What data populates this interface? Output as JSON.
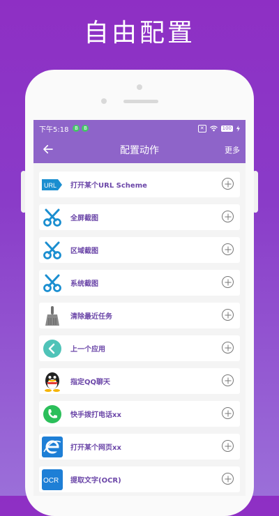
{
  "hero_title": "自由配置",
  "status": {
    "time": "下午5:18",
    "badge1": "B",
    "badge2": "B",
    "right_box": "✕",
    "battery": "100"
  },
  "appbar": {
    "title": "配置动作",
    "more_label": "更多"
  },
  "items": [
    {
      "label": "打开某个URL Scheme",
      "icon": "url-icon",
      "icon_text": "URL"
    },
    {
      "label": "全屏截图",
      "icon": "scissors-icon"
    },
    {
      "label": "区域截图",
      "icon": "scissors-icon"
    },
    {
      "label": "系统截图",
      "icon": "scissors-icon"
    },
    {
      "label": "清除最近任务",
      "icon": "broom-icon"
    },
    {
      "label": "上一个应用",
      "icon": "back-arrow-icon"
    },
    {
      "label": "指定QQ聊天",
      "icon": "qq-penguin-icon"
    },
    {
      "label": "快手拨打电话xx",
      "icon": "phone-icon"
    },
    {
      "label": "打开某个网页xx",
      "icon": "browser-e-icon"
    },
    {
      "label": "提取文字(OCR)",
      "icon": "ocr-icon",
      "icon_text": "OCR"
    }
  ],
  "colors": {
    "accent": "#8e64c9",
    "label": "#6b46a8",
    "scissors": "#1a8ed0"
  }
}
